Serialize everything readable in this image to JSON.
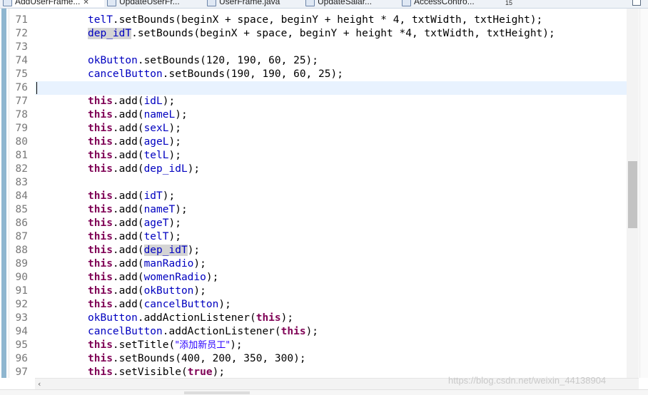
{
  "tabs": [
    {
      "label": "AddUserFrame...",
      "close": "✕"
    },
    {
      "label": "UpdateUserFr..."
    },
    {
      "label": "UserFrame.java"
    },
    {
      "label": "UpdateSalar..."
    },
    {
      "label": "AccessContro..."
    }
  ],
  "tab_overflow_count": "15",
  "watermark": "https://blog.csdn.net/weixin_44138904",
  "colors": {
    "keyword": "#7f0055",
    "field": "#0000c0",
    "string": "#2a00ff",
    "current_line": "#e8f2fe"
  },
  "lines": [
    {
      "n": "71",
      "t": [
        {
          "c": "fld",
          "s": "telT"
        },
        {
          "c": "plain",
          "s": ".setBounds(beginX + space, beginY + height * 4, txtWidth, txtHeight);"
        }
      ]
    },
    {
      "n": "72",
      "t": [
        {
          "c": "fld occ",
          "s": "dep_idT"
        },
        {
          "c": "plain",
          "s": ".setBounds(beginX + space, beginY + height *4, txtWidth, txtHeight);"
        }
      ]
    },
    {
      "n": "73",
      "t": []
    },
    {
      "n": "74",
      "t": [
        {
          "c": "fld",
          "s": "okButton"
        },
        {
          "c": "plain",
          "s": ".setBounds(120, 190, 60, 25);"
        }
      ]
    },
    {
      "n": "75",
      "t": [
        {
          "c": "fld",
          "s": "cancelButton"
        },
        {
          "c": "plain",
          "s": ".setBounds(190, 190, 60, 25);"
        }
      ]
    },
    {
      "n": "76",
      "t": [],
      "current": true
    },
    {
      "n": "77",
      "t": [
        {
          "c": "kw",
          "s": "this"
        },
        {
          "c": "plain",
          "s": ".add("
        },
        {
          "c": "fld",
          "s": "idL"
        },
        {
          "c": "plain",
          "s": ");"
        }
      ]
    },
    {
      "n": "78",
      "t": [
        {
          "c": "kw",
          "s": "this"
        },
        {
          "c": "plain",
          "s": ".add("
        },
        {
          "c": "fld",
          "s": "nameL"
        },
        {
          "c": "plain",
          "s": ");"
        }
      ]
    },
    {
      "n": "79",
      "t": [
        {
          "c": "kw",
          "s": "this"
        },
        {
          "c": "plain",
          "s": ".add("
        },
        {
          "c": "fld",
          "s": "sexL"
        },
        {
          "c": "plain",
          "s": ");"
        }
      ]
    },
    {
      "n": "80",
      "t": [
        {
          "c": "kw",
          "s": "this"
        },
        {
          "c": "plain",
          "s": ".add("
        },
        {
          "c": "fld",
          "s": "ageL"
        },
        {
          "c": "plain",
          "s": ");"
        }
      ]
    },
    {
      "n": "81",
      "t": [
        {
          "c": "kw",
          "s": "this"
        },
        {
          "c": "plain",
          "s": ".add("
        },
        {
          "c": "fld",
          "s": "telL"
        },
        {
          "c": "plain",
          "s": ");"
        }
      ]
    },
    {
      "n": "82",
      "t": [
        {
          "c": "kw",
          "s": "this"
        },
        {
          "c": "plain",
          "s": ".add("
        },
        {
          "c": "fld",
          "s": "dep_idL"
        },
        {
          "c": "plain",
          "s": ");"
        }
      ]
    },
    {
      "n": "83",
      "t": []
    },
    {
      "n": "84",
      "t": [
        {
          "c": "kw",
          "s": "this"
        },
        {
          "c": "plain",
          "s": ".add("
        },
        {
          "c": "fld",
          "s": "idT"
        },
        {
          "c": "plain",
          "s": ");"
        }
      ]
    },
    {
      "n": "85",
      "t": [
        {
          "c": "kw",
          "s": "this"
        },
        {
          "c": "plain",
          "s": ".add("
        },
        {
          "c": "fld",
          "s": "nameT"
        },
        {
          "c": "plain",
          "s": ");"
        }
      ]
    },
    {
      "n": "86",
      "t": [
        {
          "c": "kw",
          "s": "this"
        },
        {
          "c": "plain",
          "s": ".add("
        },
        {
          "c": "fld",
          "s": "ageT"
        },
        {
          "c": "plain",
          "s": ");"
        }
      ]
    },
    {
      "n": "87",
      "t": [
        {
          "c": "kw",
          "s": "this"
        },
        {
          "c": "plain",
          "s": ".add("
        },
        {
          "c": "fld",
          "s": "telT"
        },
        {
          "c": "plain",
          "s": ");"
        }
      ]
    },
    {
      "n": "88",
      "t": [
        {
          "c": "kw",
          "s": "this"
        },
        {
          "c": "plain",
          "s": ".add("
        },
        {
          "c": "fld occ",
          "s": "dep_idT"
        },
        {
          "c": "plain",
          "s": ");"
        }
      ]
    },
    {
      "n": "89",
      "t": [
        {
          "c": "kw",
          "s": "this"
        },
        {
          "c": "plain",
          "s": ".add("
        },
        {
          "c": "fld",
          "s": "manRadio"
        },
        {
          "c": "plain",
          "s": ");"
        }
      ]
    },
    {
      "n": "90",
      "t": [
        {
          "c": "kw",
          "s": "this"
        },
        {
          "c": "plain",
          "s": ".add("
        },
        {
          "c": "fld",
          "s": "womenRadio"
        },
        {
          "c": "plain",
          "s": ");"
        }
      ]
    },
    {
      "n": "91",
      "t": [
        {
          "c": "kw",
          "s": "this"
        },
        {
          "c": "plain",
          "s": ".add("
        },
        {
          "c": "fld",
          "s": "okButton"
        },
        {
          "c": "plain",
          "s": ");"
        }
      ]
    },
    {
      "n": "92",
      "t": [
        {
          "c": "kw",
          "s": "this"
        },
        {
          "c": "plain",
          "s": ".add("
        },
        {
          "c": "fld",
          "s": "cancelButton"
        },
        {
          "c": "plain",
          "s": ");"
        }
      ]
    },
    {
      "n": "93",
      "t": [
        {
          "c": "fld",
          "s": "okButton"
        },
        {
          "c": "plain",
          "s": ".addActionListener("
        },
        {
          "c": "kw",
          "s": "this"
        },
        {
          "c": "plain",
          "s": ");"
        }
      ]
    },
    {
      "n": "94",
      "t": [
        {
          "c": "fld",
          "s": "cancelButton"
        },
        {
          "c": "plain",
          "s": ".addActionListener("
        },
        {
          "c": "kw",
          "s": "this"
        },
        {
          "c": "plain",
          "s": ");"
        }
      ]
    },
    {
      "n": "95",
      "t": [
        {
          "c": "kw",
          "s": "this"
        },
        {
          "c": "plain",
          "s": ".setTitle("
        },
        {
          "c": "str",
          "s": "\"添加新员工\""
        },
        {
          "c": "plain",
          "s": ");"
        }
      ]
    },
    {
      "n": "96",
      "t": [
        {
          "c": "kw",
          "s": "this"
        },
        {
          "c": "plain",
          "s": ".setBounds(400, 200, 350, 300);"
        }
      ]
    },
    {
      "n": "97",
      "t": [
        {
          "c": "kw",
          "s": "this"
        },
        {
          "c": "plain",
          "s": ".setVisible("
        },
        {
          "c": "kw",
          "s": "true"
        },
        {
          "c": "plain",
          "s": ");"
        }
      ]
    }
  ]
}
